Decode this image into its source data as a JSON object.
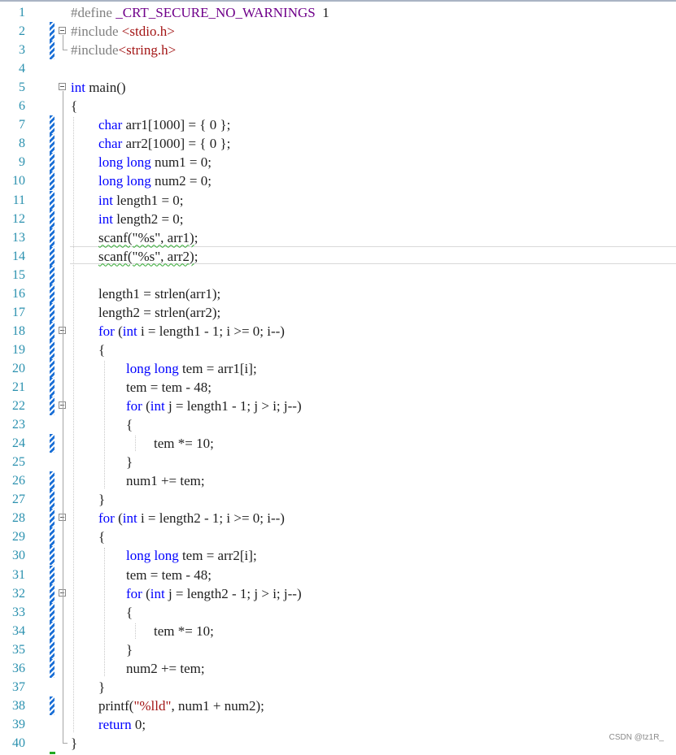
{
  "editor": {
    "lines": [
      {
        "n": "1",
        "c": [
          [
            "pp",
            "#define "
          ],
          [
            "mac",
            "_CRT_SECURE_NO_WARNINGS"
          ],
          [
            "",
            "  1"
          ]
        ]
      },
      {
        "n": "2",
        "c": [
          [
            "pp",
            "#include "
          ],
          [
            "inc",
            "<stdio.h>"
          ]
        ]
      },
      {
        "n": "3",
        "c": [
          [
            "pp",
            "#include"
          ],
          [
            "inc",
            "<string.h>"
          ]
        ]
      },
      {
        "n": "4",
        "c": []
      },
      {
        "n": "5",
        "c": [
          [
            "kw",
            "int"
          ],
          [
            "",
            " main()"
          ]
        ]
      },
      {
        "n": "6",
        "c": [
          [
            "",
            "{"
          ]
        ]
      },
      {
        "n": "7",
        "c": [
          [
            "",
            "        "
          ],
          [
            "kw",
            "char"
          ],
          [
            "",
            " arr1[1000] = { 0 };"
          ]
        ]
      },
      {
        "n": "8",
        "c": [
          [
            "",
            "        "
          ],
          [
            "kw",
            "char"
          ],
          [
            "",
            " arr2[1000] = { 0 };"
          ]
        ]
      },
      {
        "n": "9",
        "c": [
          [
            "",
            "        "
          ],
          [
            "kw",
            "long long"
          ],
          [
            "",
            " num1 = 0;"
          ]
        ]
      },
      {
        "n": "10",
        "c": [
          [
            "",
            "        "
          ],
          [
            "kw",
            "long long"
          ],
          [
            "",
            " num2 = 0;"
          ]
        ]
      },
      {
        "n": "11",
        "c": [
          [
            "",
            "        "
          ],
          [
            "kw",
            "int"
          ],
          [
            "",
            " length1 = 0;"
          ]
        ]
      },
      {
        "n": "12",
        "c": [
          [
            "",
            "        "
          ],
          [
            "kw",
            "int"
          ],
          [
            "",
            " length2 = 0;"
          ]
        ]
      },
      {
        "n": "13",
        "c": [
          [
            "",
            "        "
          ],
          [
            "squig",
            "scanf(\"%s\", arr1)"
          ],
          [
            "",
            ";"
          ]
        ]
      },
      {
        "n": "14",
        "c": [
          [
            "",
            "        "
          ],
          [
            "squig",
            "scanf(\"%s\", arr2)"
          ],
          [
            "",
            ";"
          ]
        ]
      },
      {
        "n": "15",
        "c": []
      },
      {
        "n": "16",
        "c": [
          [
            "",
            "        length1 = strlen(arr1);"
          ]
        ]
      },
      {
        "n": "17",
        "c": [
          [
            "",
            "        length2 = strlen(arr2);"
          ]
        ]
      },
      {
        "n": "18",
        "c": [
          [
            "",
            "        "
          ],
          [
            "kw",
            "for"
          ],
          [
            "",
            " ("
          ],
          [
            "kw",
            "int"
          ],
          [
            "",
            " i = length1 - 1; i >= 0; i--)"
          ]
        ]
      },
      {
        "n": "19",
        "c": [
          [
            "",
            "        {"
          ]
        ]
      },
      {
        "n": "20",
        "c": [
          [
            "",
            "                "
          ],
          [
            "kw",
            "long long"
          ],
          [
            "",
            " tem = arr1[i];"
          ]
        ]
      },
      {
        "n": "21",
        "c": [
          [
            "",
            "                tem = tem - 48;"
          ]
        ]
      },
      {
        "n": "22",
        "c": [
          [
            "",
            "                "
          ],
          [
            "kw",
            "for"
          ],
          [
            "",
            " ("
          ],
          [
            "kw",
            "int"
          ],
          [
            "",
            " j = length1 - 1; j > i; j--)"
          ]
        ]
      },
      {
        "n": "23",
        "c": [
          [
            "",
            "                {"
          ]
        ]
      },
      {
        "n": "24",
        "c": [
          [
            "",
            "                        tem *= 10;"
          ]
        ]
      },
      {
        "n": "25",
        "c": [
          [
            "",
            "                }"
          ]
        ]
      },
      {
        "n": "26",
        "c": [
          [
            "",
            "                num1 += tem;"
          ]
        ]
      },
      {
        "n": "27",
        "c": [
          [
            "",
            "        }"
          ]
        ]
      },
      {
        "n": "28",
        "c": [
          [
            "",
            "        "
          ],
          [
            "kw",
            "for"
          ],
          [
            "",
            " ("
          ],
          [
            "kw",
            "int"
          ],
          [
            "",
            " i = length2 - 1; i >= 0; i--)"
          ]
        ]
      },
      {
        "n": "29",
        "c": [
          [
            "",
            "        {"
          ]
        ]
      },
      {
        "n": "30",
        "c": [
          [
            "",
            "                "
          ],
          [
            "kw",
            "long long"
          ],
          [
            "",
            " tem = arr2[i];"
          ]
        ]
      },
      {
        "n": "31",
        "c": [
          [
            "",
            "                tem = tem - 48;"
          ]
        ]
      },
      {
        "n": "32",
        "c": [
          [
            "",
            "                "
          ],
          [
            "kw",
            "for"
          ],
          [
            "",
            " ("
          ],
          [
            "kw",
            "int"
          ],
          [
            "",
            " j = length2 - 1; j > i; j--)"
          ]
        ]
      },
      {
        "n": "33",
        "c": [
          [
            "",
            "                {"
          ]
        ]
      },
      {
        "n": "34",
        "c": [
          [
            "",
            "                        tem *= 10;"
          ]
        ]
      },
      {
        "n": "35",
        "c": [
          [
            "",
            "                }"
          ]
        ]
      },
      {
        "n": "36",
        "c": [
          [
            "",
            "                num2 += tem;"
          ]
        ]
      },
      {
        "n": "37",
        "c": [
          [
            "",
            "        }"
          ]
        ]
      },
      {
        "n": "38",
        "c": [
          [
            "",
            "        printf("
          ],
          [
            "str",
            "\"%lld\""
          ],
          [
            "",
            ", num1 + num2);"
          ]
        ]
      },
      {
        "n": "39",
        "c": [
          [
            "",
            "        "
          ],
          [
            "kw",
            "return"
          ],
          [
            "",
            " 0;"
          ]
        ]
      },
      {
        "n": "40",
        "c": [
          [
            "",
            "}"
          ]
        ]
      }
    ],
    "changed_lines": [
      2,
      3,
      7,
      8,
      9,
      10,
      11,
      12,
      13,
      14,
      15,
      16,
      17,
      18,
      19,
      20,
      21,
      22,
      24,
      26,
      27,
      28,
      29,
      30,
      31,
      32,
      33,
      34,
      35,
      36,
      38
    ],
    "fold_lines": [
      2,
      5,
      18,
      22,
      28,
      32
    ],
    "current_line": 14
  },
  "watermark": "CSDN @tz1R_",
  "colors": {
    "keyword": "#0000ff",
    "preprocessor": "#808080",
    "macro": "#6f008a",
    "string": "#a31515",
    "line_number": "#2b91af",
    "change_bar": "#1a6fd6"
  }
}
